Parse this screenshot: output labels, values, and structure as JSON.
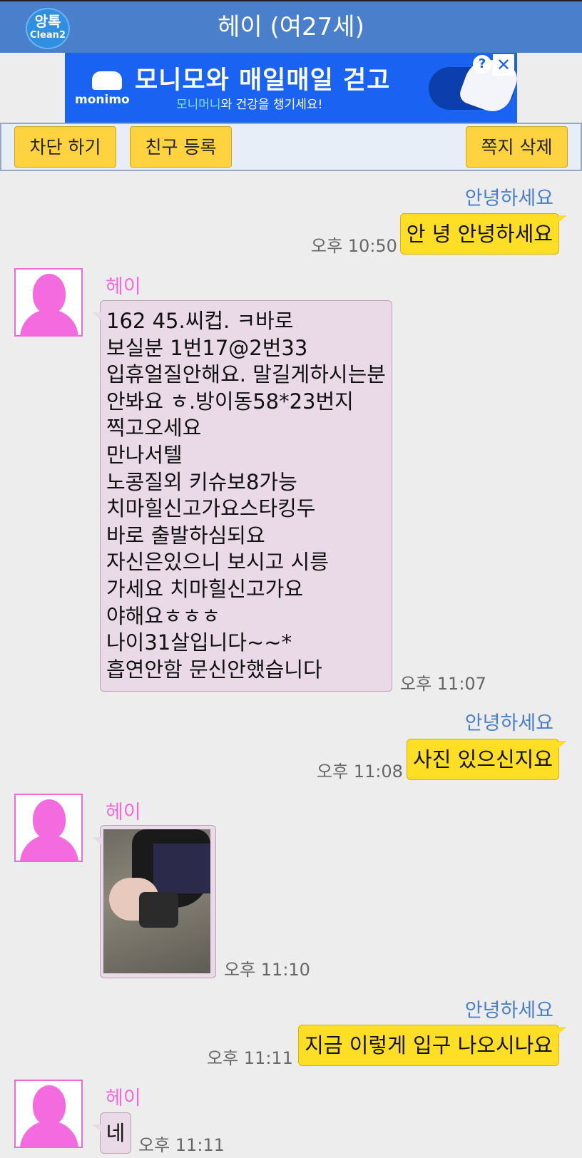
{
  "header": {
    "logo_korean": "앙톡",
    "logo_english": "Clean2",
    "title": "헤이 (여27세)"
  },
  "ad": {
    "brand": "monimo",
    "headline": "모니모와 매일매일 걷고",
    "sub_highlight": "모니머니",
    "sub_rest": "와 건강을 챙기세요!",
    "help_glyph": "?",
    "close_glyph": "✕"
  },
  "toolbar": {
    "block_label": "차단 하기",
    "friend_label": "친구 등록",
    "delete_label": "쪽지 삭제"
  },
  "messages": [
    {
      "from": "me",
      "sender": "안녕하세요",
      "text": "안 녕 안녕하세요",
      "time": "오후 10:50"
    },
    {
      "from": "other",
      "sender": "헤이",
      "time": "오후 11:07",
      "lines": [
        "162 45.씨컵.  ㅋ바로",
        "보실분 1번17@2번33",
        "입휴얼질안해요. 말길게하시는분",
        "안봐요 ㅎ.방이동58*23번지",
        "찍고오세요",
        "만나서텔",
        "노콩질외 키슈보8가능",
        "치마힐신고가요스타킹두",
        "바로 출발하심되요",
        "자신은있으니 보시고 시릉",
        "가세요  치마힐신고가요",
        "야해요ㅎㅎㅎ",
        "나이31살입니다~~*",
        "흡연안함 문신안했습니다"
      ]
    },
    {
      "from": "me",
      "sender": "안녕하세요",
      "text": "사진 있으신지요",
      "time": "오후 11:08"
    },
    {
      "from": "other",
      "sender": "헤이",
      "type": "photo",
      "time": "오후 11:10"
    },
    {
      "from": "me",
      "sender": "안녕하세요",
      "text": "지금 이렇게 입구 나오시나요",
      "time": "오후 11:11"
    },
    {
      "from": "other",
      "sender": "헤이",
      "text": "네",
      "time": "오후 11:11"
    }
  ]
}
